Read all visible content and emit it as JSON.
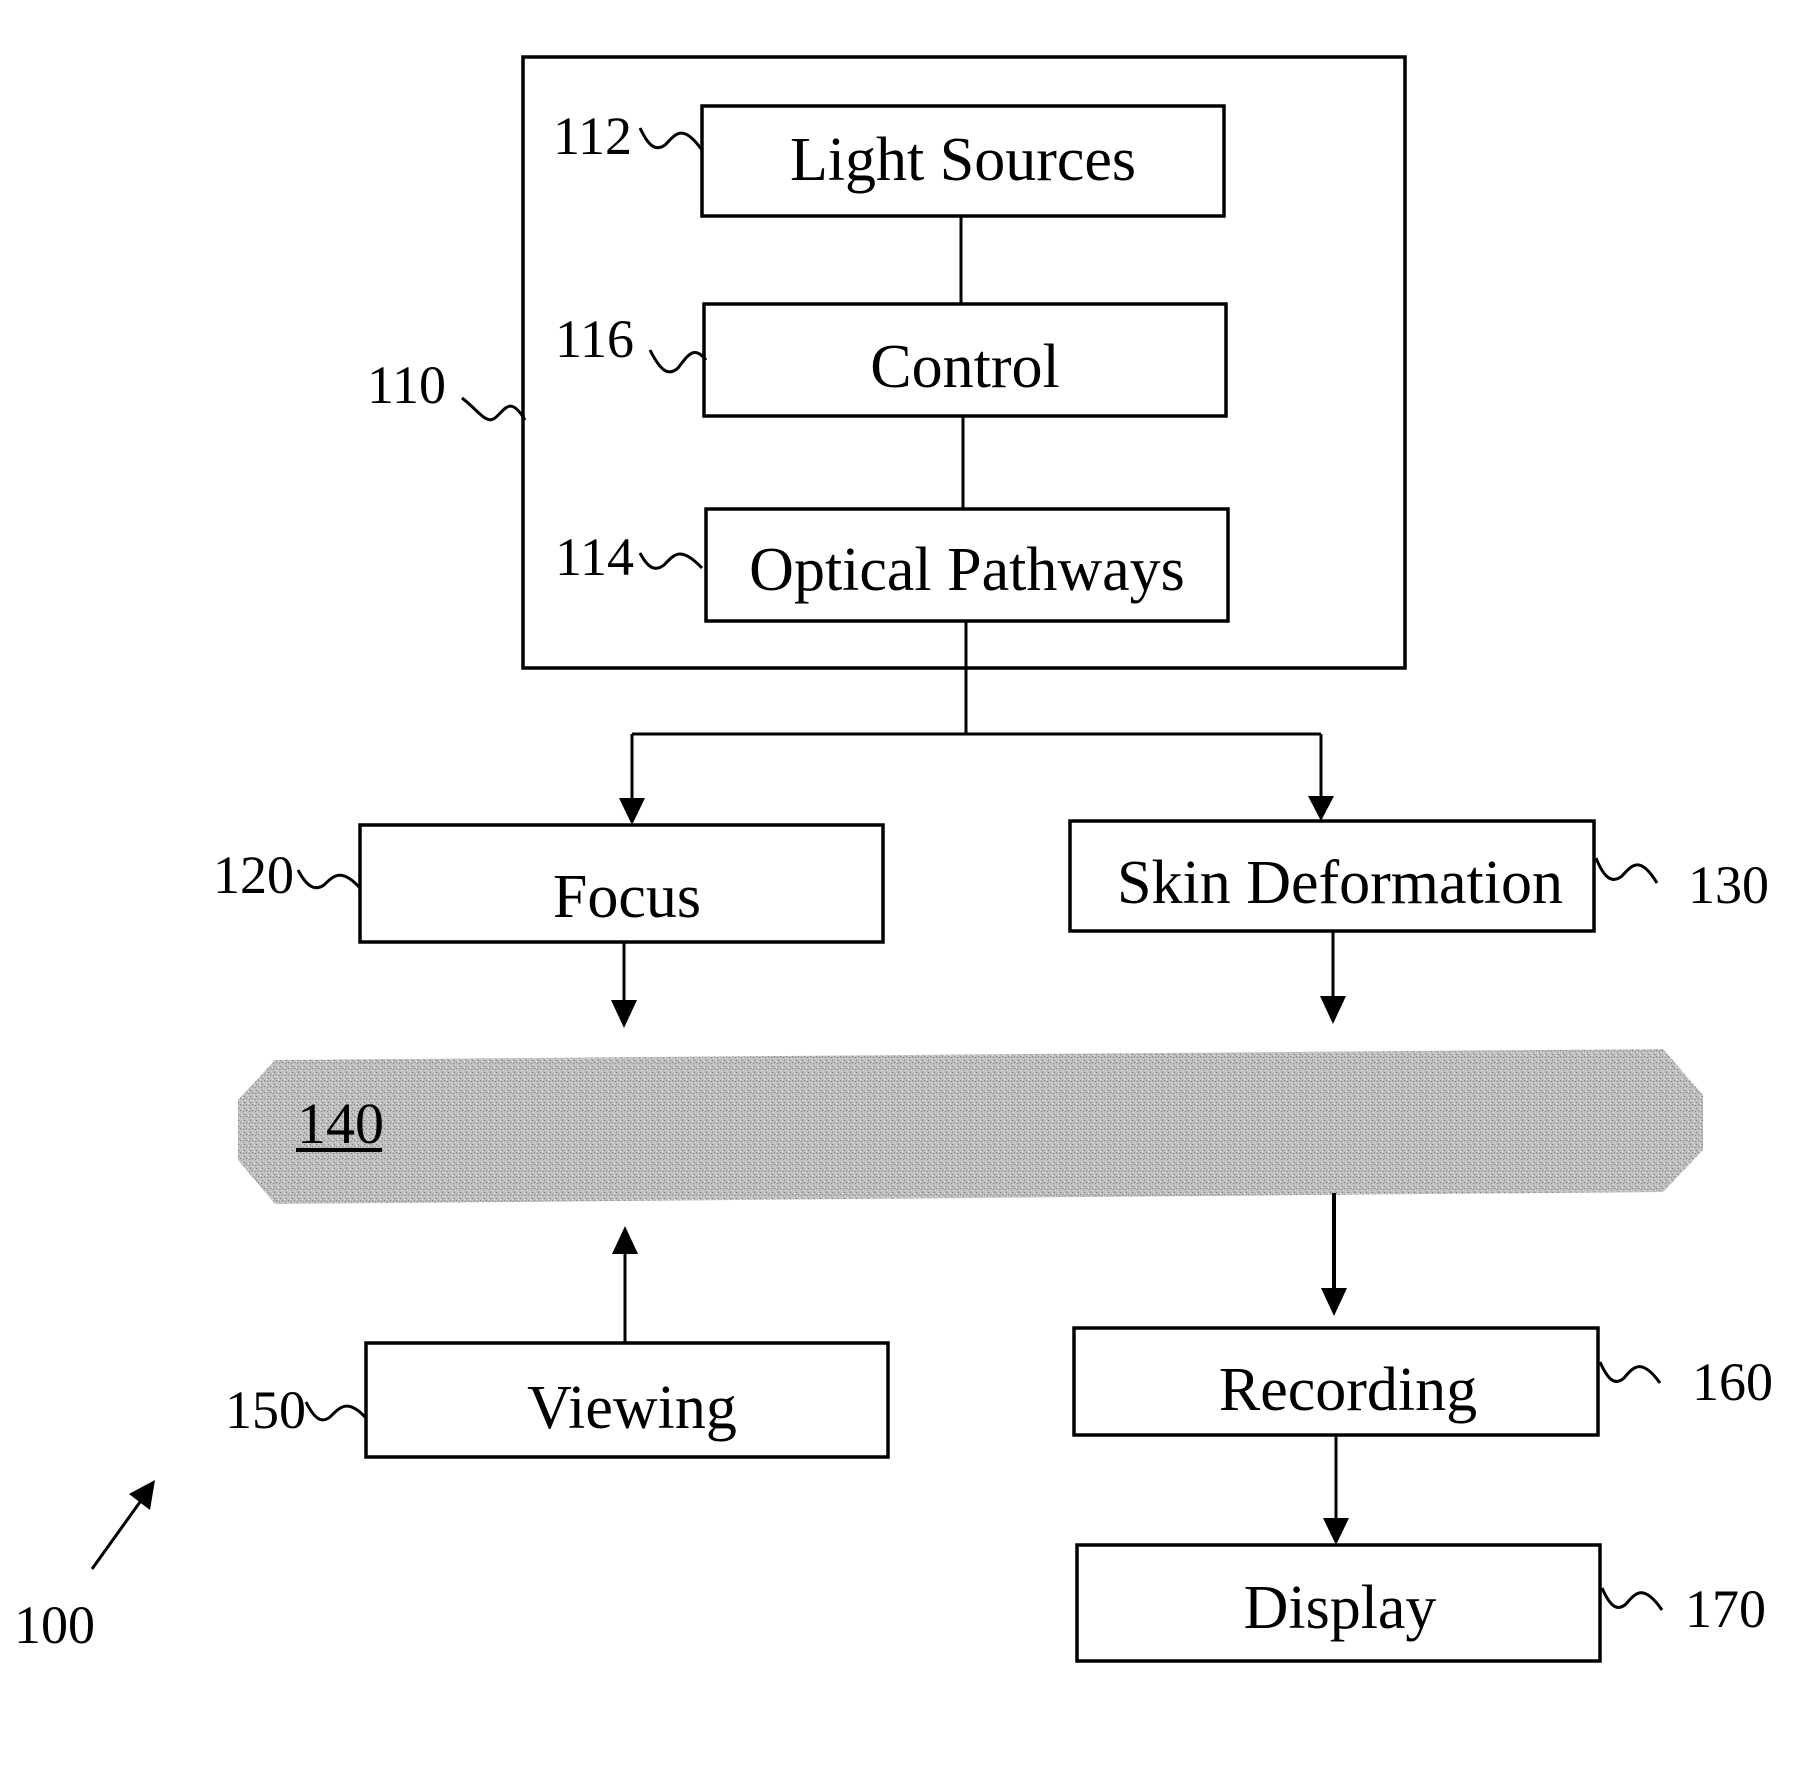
{
  "figure": {
    "reference": "100",
    "system_group": {
      "reference": "110",
      "components": [
        {
          "id": "light-sources",
          "label": "Light Sources",
          "reference": "112"
        },
        {
          "id": "control",
          "label": "Control",
          "reference": "116"
        },
        {
          "id": "optical-pathways",
          "label": "Optical Pathways",
          "reference": "114"
        }
      ]
    },
    "blocks": [
      {
        "id": "focus",
        "label": "Focus",
        "reference": "120"
      },
      {
        "id": "skin-deformation",
        "label": "Skin Deformation",
        "reference": "130"
      },
      {
        "id": "viewing",
        "label": "Viewing",
        "reference": "150"
      },
      {
        "id": "recording",
        "label": "Recording",
        "reference": "160"
      },
      {
        "id": "display",
        "label": "Display",
        "reference": "170"
      }
    ],
    "subject_band": {
      "reference": "140",
      "fill_color": "#b9b9b9"
    },
    "connections": [
      {
        "from": "light-sources",
        "to": "control",
        "type": "line"
      },
      {
        "from": "control",
        "to": "optical-pathways",
        "type": "line"
      },
      {
        "from": "optical-pathways",
        "to": "focus",
        "type": "arrow"
      },
      {
        "from": "optical-pathways",
        "to": "skin-deformation",
        "type": "arrow"
      },
      {
        "from": "focus",
        "to": "140",
        "type": "arrow"
      },
      {
        "from": "skin-deformation",
        "to": "140",
        "type": "arrow"
      },
      {
        "from": "viewing",
        "to": "140",
        "type": "arrow"
      },
      {
        "from": "140",
        "to": "recording",
        "type": "arrow"
      },
      {
        "from": "recording",
        "to": "display",
        "type": "arrow"
      }
    ]
  }
}
